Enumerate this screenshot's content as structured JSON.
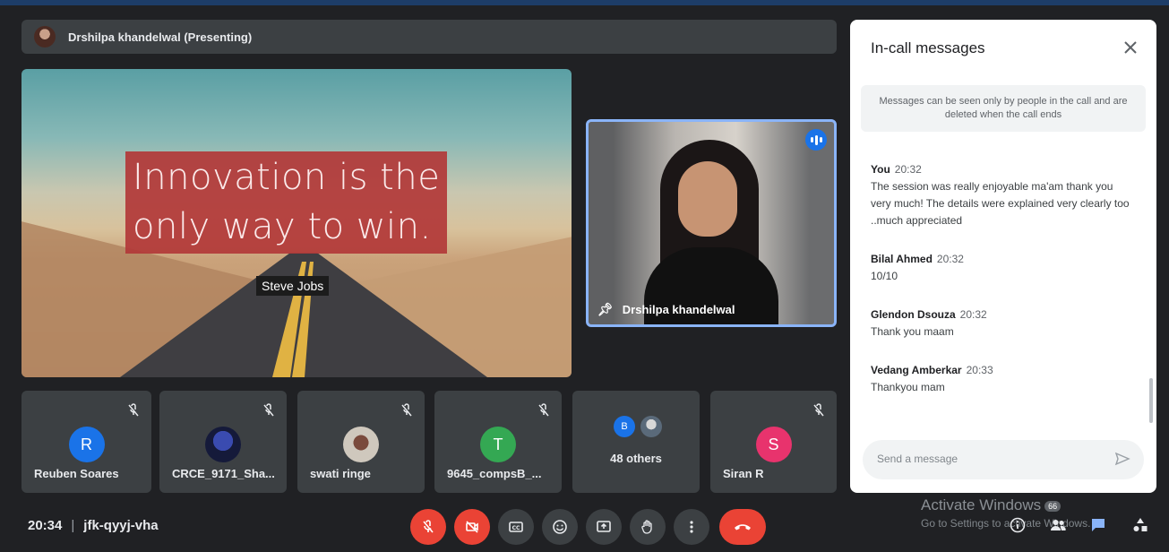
{
  "presenter": {
    "label": "Drshilpa khandelwal (Presenting)"
  },
  "slide": {
    "quote_line1": "Innovation is the",
    "quote_line2": "only way to win.",
    "author": "Steve Jobs"
  },
  "featured": {
    "name": "Drshilpa khandelwal"
  },
  "participants": [
    {
      "initial": "R",
      "name": "Reuben Soares",
      "color": "#1a73e8"
    },
    {
      "initial": "",
      "name": "CRCE_9171_Sha...",
      "color": "#2d2f5a"
    },
    {
      "initial": "",
      "name": "swati ringe",
      "color": "#d9d4cc"
    },
    {
      "initial": "T",
      "name": "9645_compsB_...",
      "color": "#34a853"
    },
    {
      "initial": "S",
      "name": "Siran R",
      "color": "#e8336d"
    }
  ],
  "others": {
    "initial": "B",
    "label": "48 others"
  },
  "meeting": {
    "time": "20:34",
    "separator": "|",
    "code": "jfk-qyyj-vha"
  },
  "watermark": {
    "line1": "Activate Windows",
    "badge": "66",
    "line2": "Go to Settings to activate Windows."
  },
  "chat": {
    "title": "In-call messages",
    "notice": "Messages can be seen only by people in the call and are deleted when the call ends",
    "messages": [
      {
        "sender": "You",
        "time": "20:32",
        "text": "The session was really enjoyable ma'am thank you very much! The details were explained very clearly too ..much appreciated"
      },
      {
        "sender": "Bilal Ahmed",
        "time": "20:32",
        "text": "10/10"
      },
      {
        "sender": "Glendon Dsouza",
        "time": "20:32",
        "text": "Thank you maam"
      },
      {
        "sender": "Vedang Amberkar",
        "time": "20:33",
        "text": "Thankyou mam"
      }
    ],
    "input_placeholder": "Send a message"
  },
  "colors": {
    "accent": "#1a73e8",
    "danger": "#ea4335",
    "tile_bg": "#3c4043"
  }
}
